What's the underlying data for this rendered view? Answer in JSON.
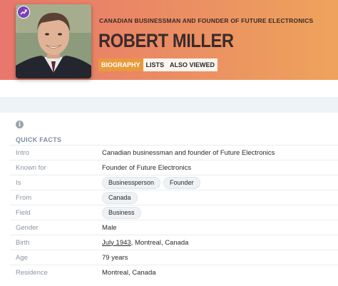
{
  "hero": {
    "subtitle": "CANADIAN BUSINESSMAN AND FOUNDER OF FUTURE ELECTRONICS",
    "name": "ROBERT MILLER",
    "badge_icon": "trending-icon",
    "gradient_start": "#e8776d",
    "gradient_end": "#eea35c"
  },
  "tabs": [
    {
      "label": "BIOGRAPHY",
      "active": true
    },
    {
      "label": "LISTS",
      "active": false
    },
    {
      "label": "ALSO VIEWED",
      "active": false
    }
  ],
  "quick_facts": {
    "title": "QUICK FACTS",
    "intro_label": "Intro",
    "intro_value": "Canadian businessman and founder of Future Electronics",
    "known_for_label": "Known for",
    "known_for_value": "Founder of Future Electronics",
    "is_label": "Is",
    "is_chips": [
      "Businessperson",
      "Founder"
    ],
    "from_label": "From",
    "from_chip": "Canada",
    "field_label": "Field",
    "field_chip": "Business",
    "gender_label": "Gender",
    "gender_value": "Male",
    "birth_label": "Birth",
    "birth_date": "July 1943",
    "birth_place": ", Montreal, Canada",
    "age_label": "Age",
    "age_value": "79 years",
    "residence_label": "Residence",
    "residence_value": "Montreal, Canada"
  }
}
